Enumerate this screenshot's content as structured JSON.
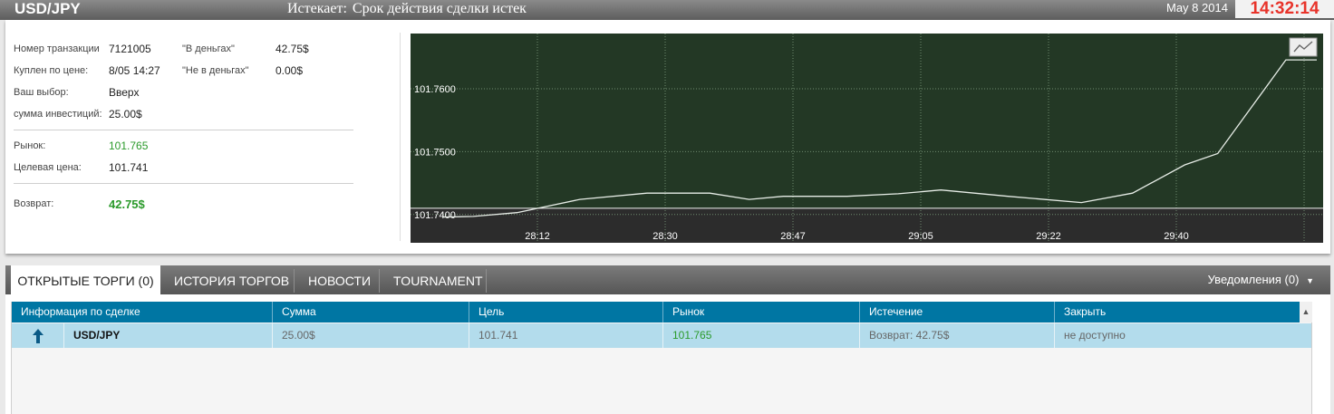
{
  "header": {
    "pair": "USD/JPY",
    "expires_label": "Истекает:",
    "expires_text": "Срок действия сделки истек",
    "date": "May 8 2014",
    "time": "14:32:14"
  },
  "trade_info": {
    "transaction_label": "Номер транзакции",
    "transaction_value": "7121005",
    "in_money_label": "\"В деньгах\"",
    "in_money_value": "42.75$",
    "bought_label": "Куплен по цене:",
    "bought_value": "8/05 14:27",
    "out_money_label": "\"Не в деньгах\"",
    "out_money_value": "0.00$",
    "choice_label": "Ваш выбор:",
    "choice_value": "Вверх",
    "investment_label": "сумма инвестиций:",
    "investment_value": "25.00$",
    "market_label": "Рынок:",
    "market_value": "101.765",
    "target_label": "Целевая цена:",
    "target_value": "101.741",
    "return_label": "Возврат:",
    "return_value": "42.75$"
  },
  "chart_data": {
    "type": "line",
    "x_ticks": [
      "28:12",
      "28:30",
      "28:47",
      "29:05",
      "29:22",
      "29:40"
    ],
    "y_ticks": [
      101.76,
      101.75,
      101.74
    ],
    "y_tick_labels": [
      "101.7600",
      "101.7500",
      "101.7400"
    ],
    "ylim": [
      101.7355,
      101.7688
    ],
    "target_price": 101.741,
    "series": [
      {
        "values": [
          101.7396,
          101.7397,
          101.7403,
          101.7424,
          101.7434,
          101.7434,
          101.7424,
          101.7429,
          101.7429,
          101.7433,
          101.7439,
          101.7429,
          101.7419,
          101.7434,
          101.7479,
          101.7497,
          101.7646,
          101.7646
        ]
      }
    ],
    "colors": {
      "background": "#233825",
      "below_target": "#2c2c2c",
      "line": "#e6ece6",
      "grid": "#6f8b6f"
    }
  },
  "tabs": [
    {
      "label": "ОТКРЫТЫЕ ТОРГИ (0)",
      "active": true
    },
    {
      "label": "ИСТОРИЯ ТОРГОВ",
      "active": false
    },
    {
      "label": "НОВОСТИ",
      "active": false
    },
    {
      "label": "TOURNAMENT",
      "active": false
    }
  ],
  "notifications": {
    "label": "Уведомления (0)"
  },
  "table": {
    "columns": [
      "Информация по сделке",
      "Сумма",
      "Цель",
      "Рынок",
      "Истечение",
      "Закрыть"
    ],
    "rows": [
      {
        "direction_icon": "arrow-up-icon",
        "pair": "USD/JPY",
        "amount": "25.00$",
        "target": "101.741",
        "market": "101.765",
        "expiry": "Возврат: 42.75$",
        "close": "не доступно"
      }
    ]
  }
}
